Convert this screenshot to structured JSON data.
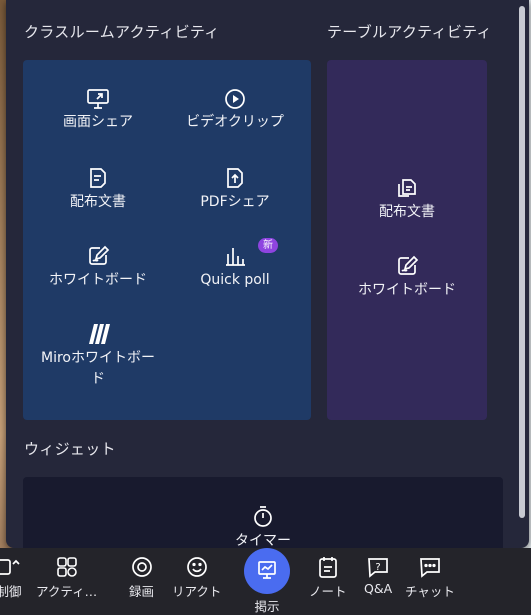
{
  "panel": {
    "classroom_header": "クラスルームアクティビティ",
    "table_header": "テーブルアクティビティ",
    "widget_header": "ウィジェット",
    "classroom_items": [
      {
        "label": "画面シェア",
        "icon": "screen-share-icon"
      },
      {
        "label": "ビデオクリップ",
        "icon": "play-circle-icon"
      },
      {
        "label": "配布文書",
        "icon": "document-icon"
      },
      {
        "label": "PDFシェア",
        "icon": "pdf-upload-icon"
      },
      {
        "label": "ホワイトボード",
        "icon": "whiteboard-pen-icon"
      },
      {
        "label": "Quick poll",
        "icon": "bar-chart-icon",
        "badge": "新"
      },
      {
        "label": "Miroホワイトボード",
        "icon": "miro-logo-icon"
      }
    ],
    "table_items": [
      {
        "label": "配布文書",
        "icon": "documents-stack-icon"
      },
      {
        "label": "ホワイトボード",
        "icon": "whiteboard-pen-icon"
      }
    ],
    "widget_items": [
      {
        "label": "タイマー",
        "icon": "timer-icon"
      }
    ]
  },
  "toolbar": {
    "items": [
      {
        "label": "制御",
        "icon": "control-icon"
      },
      {
        "label": "アクティ…",
        "icon": "activities-icon"
      },
      {
        "label": "録画",
        "icon": "record-icon"
      },
      {
        "label": "リアクト",
        "icon": "smiley-icon"
      },
      {
        "label": "掲示",
        "icon": "present-icon"
      },
      {
        "label": "ノート",
        "icon": "notes-icon"
      },
      {
        "label": "Q&A",
        "icon": "qa-icon"
      },
      {
        "label": "チャット",
        "icon": "chat-icon"
      }
    ]
  },
  "colors": {
    "panel_bg": "#25273a",
    "classroom_card": "#1f3a66",
    "table_card": "#332a5a",
    "widget_card": "#181a2e",
    "badge": "#8e44e0",
    "share_button": "#4a6cf0"
  }
}
